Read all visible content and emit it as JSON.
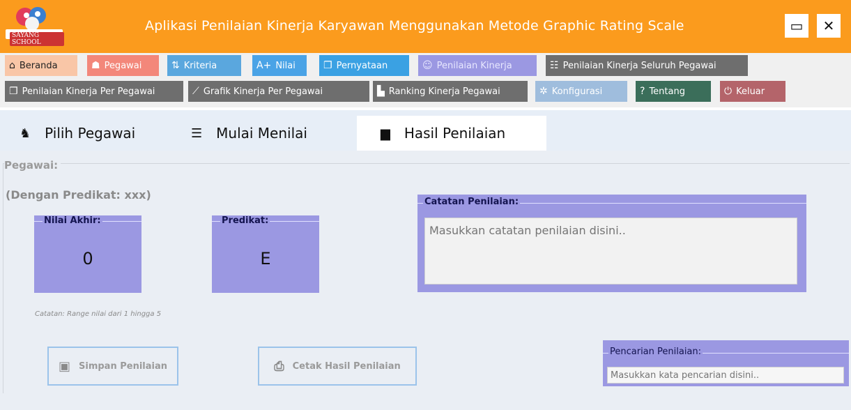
{
  "app": {
    "logo_text": "SAYANG SCHOOL",
    "title": "Aplikasi Penilaian Kinerja Karyawan Menggunakan Metode Graphic Rating Scale",
    "maximize_icon": "▭",
    "close_icon": "✕"
  },
  "menu": {
    "row1": [
      {
        "label": "Beranda",
        "icon": "⌂",
        "color": "#f9c6a7",
        "text": "#222"
      },
      {
        "label": "Pegawai",
        "icon": "☗",
        "color": "#f3877a",
        "text": "#fff"
      },
      {
        "label": "Kriteria",
        "icon": "⇅",
        "color": "#5aa7de",
        "text": "#fff"
      },
      {
        "label": "Nilai",
        "icon": "A+",
        "color": "#4aa3e6",
        "text": "#fff"
      },
      {
        "label": "Pernyataan",
        "icon": "❐",
        "color": "#3aa1e3",
        "text": "#fff"
      },
      {
        "label": "Penilaian Kinerja",
        "icon": "☺",
        "color": "#9b98e2",
        "text": "#e8e8ff"
      },
      {
        "label": "Penilaian Kinerja Seluruh Pegawai",
        "icon": "☷",
        "color": "#6e6e6e",
        "text": "#fff"
      }
    ],
    "row2": [
      {
        "label": "Penilaian Kinerja Per Pegawai",
        "icon": "❐",
        "color": "#6e6e6e",
        "text": "#fff"
      },
      {
        "label": "Grafik Kinerja Per Pegawai",
        "icon": "⟋",
        "color": "#6e6e6e",
        "text": "#fff"
      },
      {
        "label": "Ranking Kinerja Pegawai",
        "icon": "▙",
        "color": "#6e6e6e",
        "text": "#fff"
      },
      {
        "label": "Konfigurasi",
        "icon": "✲",
        "color": "#9fbddd",
        "text": "#fff"
      },
      {
        "label": "Tentang",
        "icon": "?",
        "color": "#3b6e5a",
        "text": "#fff"
      },
      {
        "label": "Keluar",
        "icon": "⏻",
        "color": "#b4646a",
        "text": "#fff"
      }
    ]
  },
  "tabs": [
    {
      "label": "Pilih Pegawai",
      "icon": "♞"
    },
    {
      "label": "Mulai Menilai",
      "icon": "☰"
    },
    {
      "label": "Hasil Penilaian",
      "icon": "▆"
    }
  ],
  "result": {
    "pegawai_label": "Pegawai:",
    "predikat_text": "(Dengan Predikat: xxx)",
    "nilai_akhir_label": "Nilai Akhir:",
    "nilai_akhir_value": "0",
    "predikat_label": "Predikat:",
    "predikat_value": "E",
    "range_note": "Catatan: Range nilai dari 1 hingga 5",
    "catatan_label": "Catatan Penilaian:",
    "catatan_placeholder": "Masukkan catatan penilaian disini..",
    "simpan_label": "Simpan Penilaian",
    "cetak_label": "Cetak Hasil Penilaian",
    "pencarian_label": "Pencarian Penilaian:",
    "pencarian_placeholder": "Masukkan kata pencarian disini.."
  }
}
